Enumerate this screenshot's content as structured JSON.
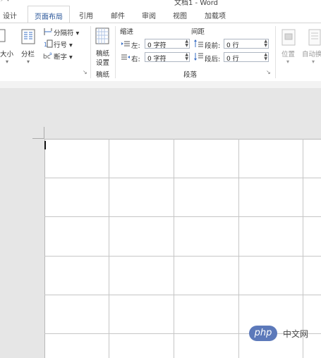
{
  "app": {
    "title": "文档1 - Word",
    "qat": "⚡ ▾"
  },
  "tabs": [
    "设计",
    "页面布局",
    "引用",
    "邮件",
    "审阅",
    "视图",
    "加载项"
  ],
  "active_tab": "页面布局",
  "ribbon": {
    "size_label": "大小",
    "columns_label": "分栏",
    "breaks_label": "分隔符 ▾",
    "line_numbers_label": "行号 ▾",
    "hyphenation_label": "断字 ▾",
    "manuscript_label_1": "稿纸",
    "manuscript_label_2": "设置",
    "manuscript_group": "稿纸",
    "indent_header": "缩进",
    "spacing_header": "间距",
    "indent_left_label": "左:",
    "indent_left_value": "0 字符",
    "indent_right_label": "右:",
    "indent_right_value": "0 字符",
    "spacing_before_label": "段前:",
    "spacing_before_value": "0 行",
    "spacing_after_label": "段后:",
    "spacing_after_value": "0 行",
    "paragraph_group": "段落",
    "position_label": "位置",
    "wrap_label": "自动换"
  },
  "watermark": {
    "logo": "php",
    "site": "中文网"
  }
}
